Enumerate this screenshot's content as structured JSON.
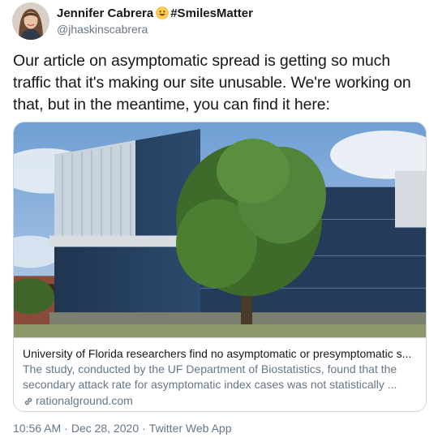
{
  "user": {
    "display_name": "Jennifer Cabrera",
    "emoji": "smiley-face-emoji",
    "hashtag": "#SmilesMatter",
    "handle": "@jhaskinscabrera",
    "avatar": "profile-photo"
  },
  "tweet": {
    "text": "Our article on asymptomatic spread is getting so much traffic that it's making our site unusable. We're working on that, but in the meantime, you can find it here:"
  },
  "card": {
    "image": "building-photo",
    "title": "University of Florida researchers find no asymptomatic or presymptomatic s...",
    "description": "The study, conducted by the UF Department of Biostatistics, found that the secondary attack rate for asymptomatic index cases was not statistically ...",
    "link_icon": "link-icon",
    "domain": "rationalground.com"
  },
  "meta": {
    "time": "10:56 AM",
    "date": "Dec 28, 2020",
    "separator": "·",
    "source": "Twitter Web App"
  },
  "colors": {
    "text_primary": "#14171a",
    "text_secondary": "#657786",
    "border": "#ccd6dd"
  }
}
